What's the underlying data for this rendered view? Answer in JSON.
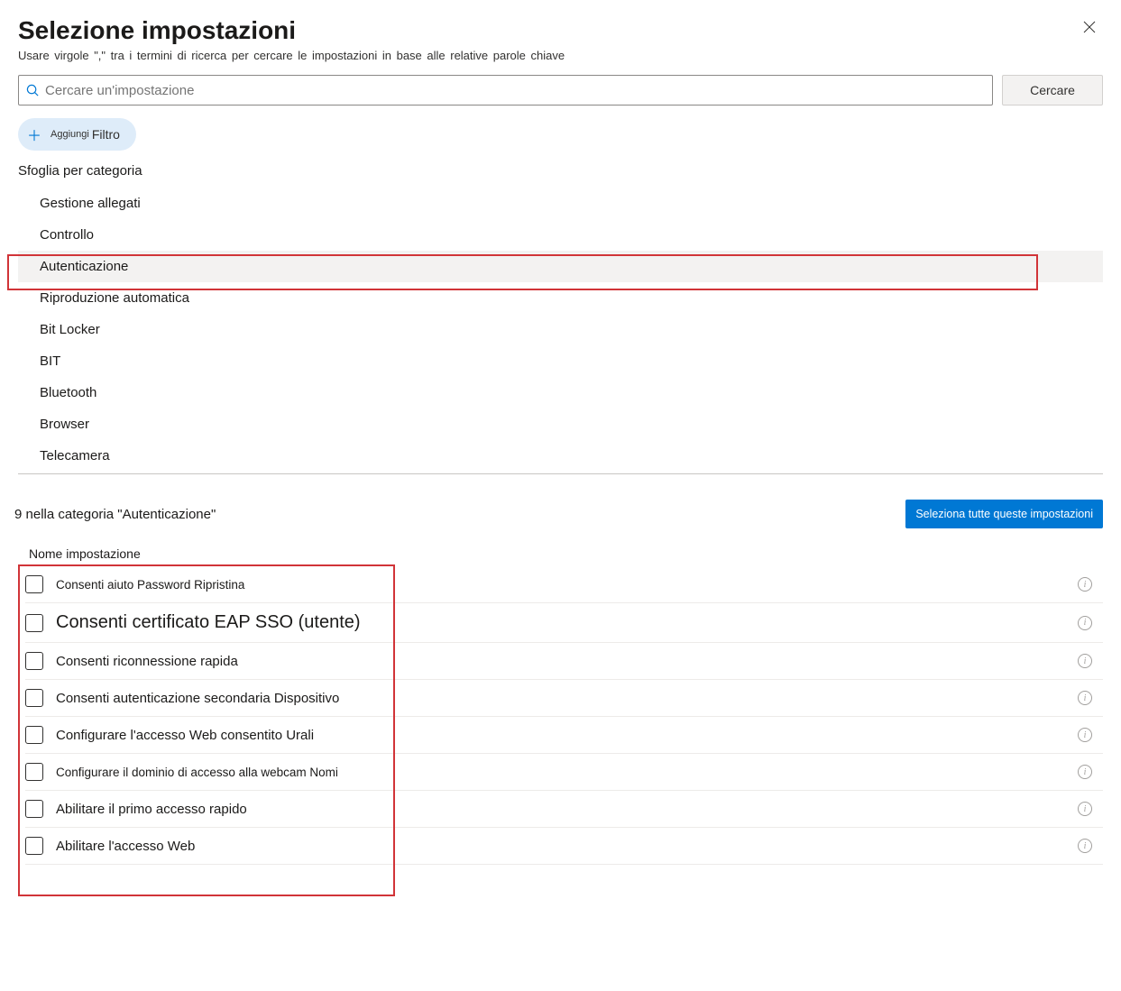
{
  "header": {
    "title": "Selezione impostazioni",
    "subtitle": "Usare virgole  \",\"  tra i termini di ricerca per cercare le impostazioni in base alle relative parole chiave"
  },
  "search": {
    "placeholder": "Cercare un'impostazione",
    "button": "Cercare"
  },
  "filter": {
    "add_prefix": "Aggiungi",
    "label": "Filtro"
  },
  "browse_label": "Sfoglia per categoria",
  "categories": [
    "Gestione allegati",
    "Controllo",
    "Autenticazione",
    "Riproduzione automatica",
    "Bit Locker",
    "BIT",
    "Bluetooth",
    "Browser",
    "Telecamera"
  ],
  "selected_category_index": 2,
  "results": {
    "count_text": "9 nella categoria \"Autenticazione\"",
    "select_all": "Seleziona tutte queste impostazioni",
    "column_header": "Nome impostazione"
  },
  "settings": [
    {
      "label": "Consenti aiuto  Password  Ripristina",
      "style": "smallish"
    },
    {
      "label": "Consenti certificato EAP SSO (utente)",
      "style": "big"
    },
    {
      "label": "Consenti riconnessione rapida",
      "style": ""
    },
    {
      "label": "Consenti autenticazione secondaria   Dispositivo",
      "style": ""
    },
    {
      "label": " Configurare l'accesso Web consentito Urali",
      "style": ""
    },
    {
      "label": "Configurare il dominio di accesso alla webcam   Nomi",
      "style": "smallish"
    },
    {
      "label": "Abilitare il primo accesso rapido",
      "style": ""
    },
    {
      "label": "Abilitare l'accesso Web",
      "style": ""
    }
  ]
}
